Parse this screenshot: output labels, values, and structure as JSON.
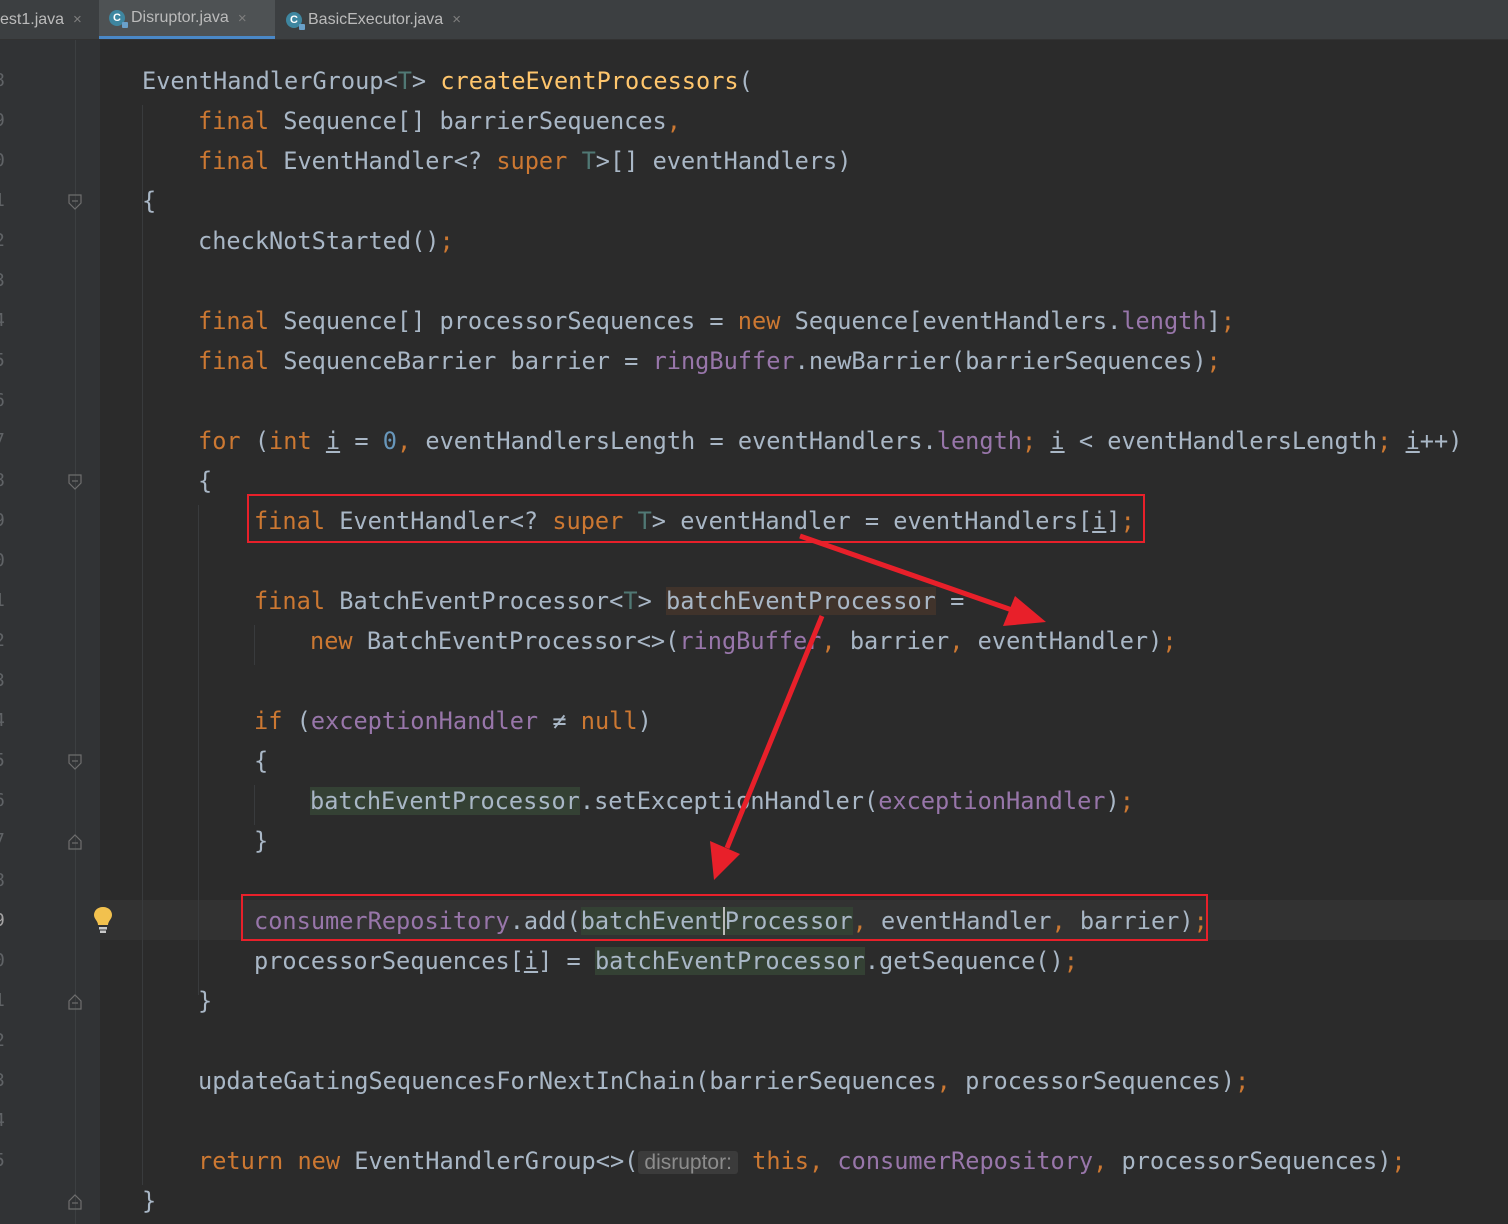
{
  "tabs": [
    {
      "label": "est1.java",
      "icon": "java-class-icon",
      "active": false
    },
    {
      "label": "Disruptor.java",
      "icon": "java-class-icon",
      "active": true
    },
    {
      "label": "BasicExecutor.java",
      "icon": "java-class-icon",
      "active": false
    }
  ],
  "tab_icon_letter": "C",
  "tab_close": "×",
  "gutter": {
    "line_digits": [
      "8",
      "9",
      "0",
      "1",
      "2",
      "3",
      "4",
      "5",
      "6",
      "7",
      "8",
      "9",
      "0",
      "1",
      "2",
      "3",
      "4",
      "5",
      "6",
      "7",
      "8",
      "9",
      "0",
      "1",
      "2",
      "3",
      "4",
      "5"
    ]
  },
  "code": {
    "l1": {
      "a": "EventHandlerGroup<",
      "b": "T",
      "c": "> ",
      "d": "createEventProcessors",
      "e": "("
    },
    "l2": {
      "a": "final",
      "b": " Sequence[] barrierSequences",
      "c": ","
    },
    "l3": {
      "a": "final",
      "b": " EventHandler<? ",
      "c": "super",
      "d": " ",
      "e": "T",
      "f": ">[] eventHandlers)"
    },
    "l4": {
      "a": "{"
    },
    "l5": {
      "a": "checkNotStarted()",
      "b": ";"
    },
    "l6": {
      "a": "final",
      "b": " Sequence[] processorSequences = ",
      "c": "new",
      "d": " Sequence[eventHandlers.",
      "e": "length",
      "f": "]",
      "g": ";"
    },
    "l7": {
      "a": "final",
      "b": " SequenceBarrier barrier = ",
      "c": "ringBuffer",
      "d": ".newBarrier(barrierSequences)",
      "e": ";"
    },
    "l8": {
      "a": "for",
      "b": " (",
      "c": "int",
      "d": " ",
      "e": "i",
      "f": " = ",
      "g": "0",
      "h": ", ",
      "i": "eventHandlersLength = eventHandlers.",
      "j": "length",
      "k": "; ",
      "l": "i",
      "m": " < eventHandlersLength",
      "n": "; ",
      "o": "i",
      "p": "++)"
    },
    "l9": {
      "a": "{"
    },
    "l10": {
      "a": "final",
      "b": " EventHandler<? ",
      "c": "super",
      "d": " ",
      "e": "T",
      "f": "> eventHandler = eventHandlers[",
      "g": "i",
      "h": "]",
      "i": ";"
    },
    "l11": {
      "a": "final",
      "b": " BatchEventProcessor<",
      "c": "T",
      "d": "> ",
      "e": "batchEventProcessor",
      "f": " ="
    },
    "l12": {
      "a": "new",
      "b": " BatchEventProcessor<>(",
      "c": "ringBuffer",
      "d": ", ",
      "e": "barrier",
      "f": ", ",
      "g": "eventHandler)",
      "h": ";"
    },
    "l13": {
      "a": "if",
      "b": " (",
      "c": "exceptionHandler",
      "d": " ≠ ",
      "e": "null",
      "f": ")"
    },
    "l14": {
      "a": "{"
    },
    "l15": {
      "a": "batchEventProcessor",
      "b": ".setExceptionHandler(",
      "c": "exceptionHandler",
      "d": ")",
      "e": ";"
    },
    "l16": {
      "a": "}"
    },
    "l17": {
      "a": "consumerRepository",
      "b": ".add(",
      "c": "batchEvent",
      "d": "Processor",
      "e": ", ",
      "f": "eventHandler",
      "g": ", ",
      "h": "barrier)",
      "i": ";"
    },
    "l18": {
      "a": "processorSequences[",
      "b": "i",
      "c": "] = ",
      "d": "batchEventProcessor",
      "e": ".getSequence()",
      "f": ";"
    },
    "l19": {
      "a": "}"
    },
    "l20": {
      "a": "updateGatingSequencesForNextInChain(barrierSequences",
      "b": ", ",
      "c": "processorSequences)",
      "d": ";"
    },
    "l21": {
      "a": "return",
      "b": " ",
      "c": "new",
      "d": " EventHandlerGroup<>(",
      "e": "disruptor:",
      "f": " ",
      "g": "this",
      "h": ", ",
      "i": "consumerRepository",
      "j": ", ",
      "k": "processorSequences)",
      "l": ";"
    },
    "l22": {
      "a": "}"
    }
  },
  "colors": {
    "background": "#2b2b2b",
    "keyword": "#cc7832",
    "method_decl": "#ffc66d",
    "field": "#9876aa",
    "number": "#6897bb",
    "annotation_red": "#e8202a"
  }
}
